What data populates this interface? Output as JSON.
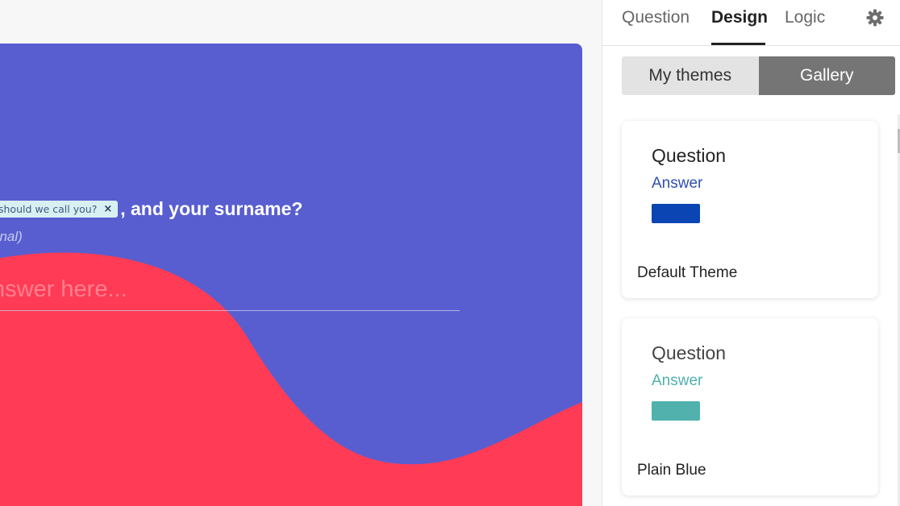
{
  "preview": {
    "question_tag": "should we call you?",
    "question_tag_close": "×",
    "question_rest": ", and your surname?",
    "optional": "onal)",
    "answer_placeholder": "nswer here...",
    "colors": {
      "background": "#585ecf",
      "wave": "#ff3b55",
      "text": "#ffffff"
    }
  },
  "panel": {
    "tabs": [
      {
        "label": "Question",
        "active": false
      },
      {
        "label": "Design",
        "active": true
      },
      {
        "label": "Logic",
        "active": false
      }
    ],
    "settings_icon": "gear-icon",
    "segments": {
      "my_themes": "My themes",
      "gallery": "Gallery",
      "selected": "Gallery"
    },
    "themes": [
      {
        "question": "Question",
        "answer": "Answer",
        "name": "Default Theme",
        "question_color": "#222222",
        "answer_color": "#2f4fb0",
        "button_color": "#0b45b3"
      },
      {
        "question": "Question",
        "answer": "Answer",
        "name": "Plain Blue",
        "question_color": "#444444",
        "answer_color": "#4fb0ad",
        "button_color": "#50b1ad"
      }
    ]
  }
}
